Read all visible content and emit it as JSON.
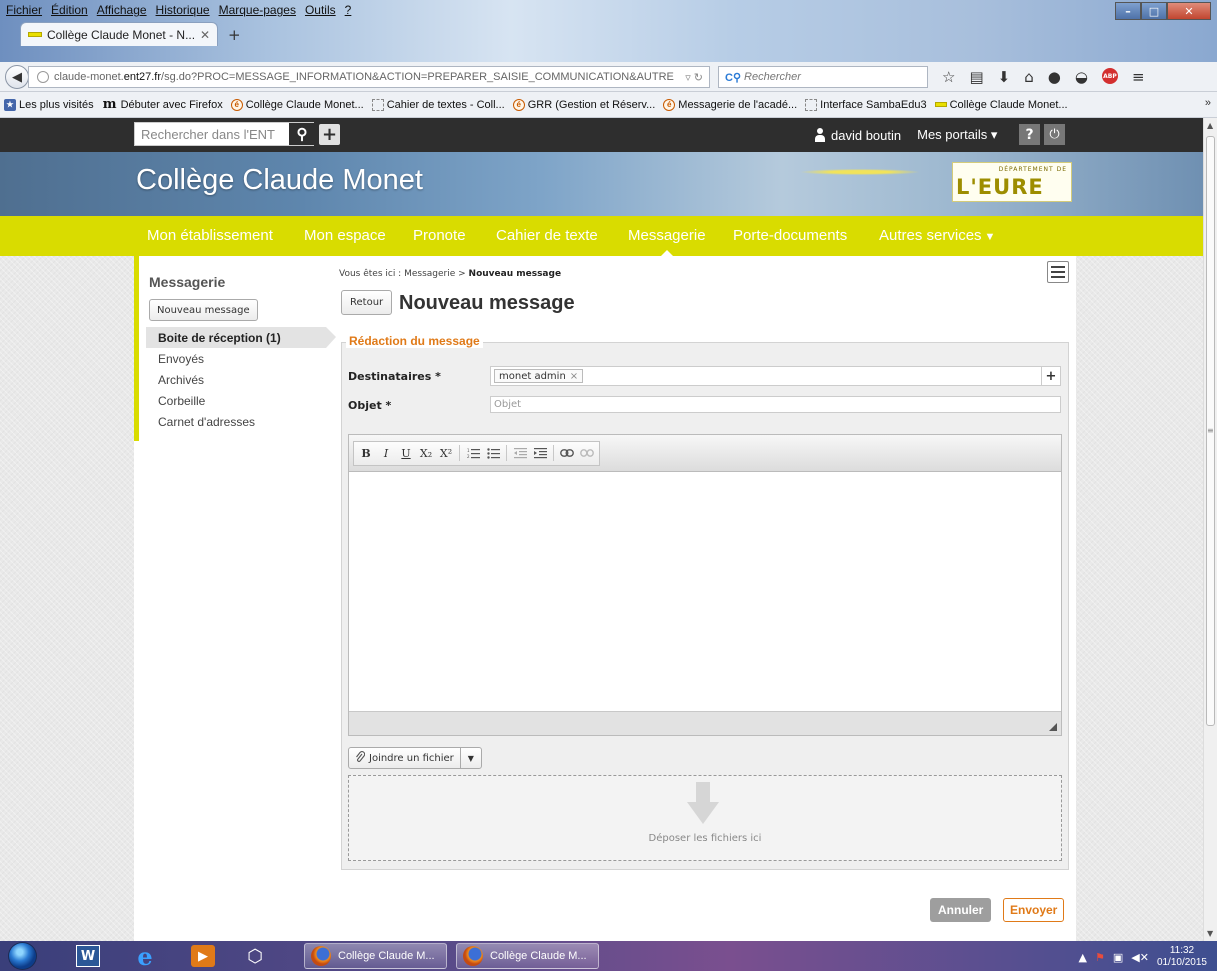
{
  "browser": {
    "menu": [
      "Fichier",
      "Édition",
      "Affichage",
      "Historique",
      "Marque-pages",
      "Outils",
      "?"
    ],
    "tab_title": "Collège Claude Monet - N...",
    "url_domain_prefix": "claude-monet.",
    "url_domain": "ent27.fr",
    "url_path": "/sg.do?PROC=MESSAGE_INFORMATION&ACTION=PREPARER_SAISIE_COMMUNICATION&AUTRE",
    "search_placeholder": "Rechercher",
    "bookmarks": [
      {
        "icon": "star",
        "label": "Les plus visités"
      },
      {
        "icon": "m",
        "label": "Débuter avec Firefox"
      },
      {
        "icon": "e",
        "label": "Collège Claude Monet..."
      },
      {
        "icon": "blank",
        "label": "Cahier de textes - Coll..."
      },
      {
        "icon": "e",
        "label": "GRR (Gestion et Réserv..."
      },
      {
        "icon": "e",
        "label": "Messagerie de l'acadé..."
      },
      {
        "icon": "blank",
        "label": "Interface SambaEdu3"
      },
      {
        "icon": "eure",
        "label": "Collège Claude Monet..."
      }
    ]
  },
  "ent": {
    "search_placeholder": "Rechercher dans l'ENT",
    "user_name": "david boutin",
    "portals_label": "Mes portails",
    "help_label": "?",
    "site_title": "Collège Claude Monet",
    "logo_dept": "DÉPARTEMENT DE",
    "logo_word": "L'EURE",
    "nav": [
      {
        "label": "Mon établissement"
      },
      {
        "label": "Mon espace"
      },
      {
        "label": "Pronote"
      },
      {
        "label": "Cahier de texte"
      },
      {
        "label": "Messagerie"
      },
      {
        "label": "Porte-documents"
      },
      {
        "label": "Autres services"
      }
    ]
  },
  "sidebar": {
    "title": "Messagerie",
    "new_button": "Nouveau message",
    "items": [
      {
        "label": "Boite de réception (1)",
        "active": true
      },
      {
        "label": "Envoyés"
      },
      {
        "label": "Archivés"
      },
      {
        "label": "Corbeille"
      },
      {
        "label": "Carnet d'adresses"
      }
    ]
  },
  "main": {
    "breadcrumb_prefix": "Vous êtes ici : Messagerie > ",
    "breadcrumb_current": "Nouveau message",
    "back_button": "Retour",
    "page_title": "Nouveau message",
    "legend": "Rédaction du message",
    "recipients_label": "Destinataires *",
    "recipient_chip": "monet admin",
    "subject_label": "Objet *",
    "subject_placeholder": "Objet",
    "editor_buttons": [
      "B",
      "I",
      "U",
      "X₂",
      "X²",
      "numbered-list",
      "bulleted-list",
      "outdent",
      "indent",
      "link",
      "unlink"
    ],
    "attach_button": "Joindre un fichier",
    "dropzone_text": "Déposer les fichiers ici",
    "cancel_button": "Annuler",
    "send_button": "Envoyer"
  },
  "taskbar": {
    "tasks": [
      "Collège Claude M...",
      "Collège Claude M..."
    ],
    "clock_time": "11:32",
    "clock_date": "01/10/2015"
  },
  "colors": {
    "ent_nav": "#d9dc00",
    "accent_orange": "#e07a18",
    "ent_topbar": "#2e2e2e"
  }
}
